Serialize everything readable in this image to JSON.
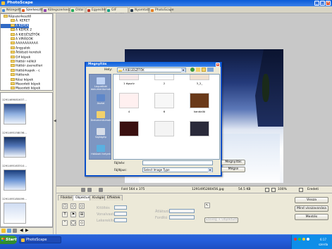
{
  "window": {
    "title": "PhotoScape",
    "min": "_",
    "max": "□",
    "close": "×"
  },
  "tabs": [
    {
      "label": "Nézegető",
      "color": "#4a8ad8"
    },
    {
      "label": "Szerkesztő",
      "color": "#e05a20"
    },
    {
      "label": "Kötegszerkesztő",
      "color": "#8e44ad"
    },
    {
      "label": "Oldal",
      "color": "#27ae60"
    },
    {
      "label": "Egyesítés",
      "color": "#c0392b"
    },
    {
      "label": "GIF animálás",
      "color": "#16a085"
    },
    {
      "label": "Nyomtatás",
      "color": "#2c3e50"
    },
    {
      "label": "PhotoScape",
      "color": "#e67e22"
    }
  ],
  "tree": [
    "Képszerkesztő",
    "Á. KERET",
    "A KÉPEK",
    "A KÉPEK 2",
    "A KIEGÉSZÍTŐK",
    "A VIRÁGOK",
    "AAAAAAAAAA",
    "Angyalok",
    "Átlátszó keretek",
    "Gif képek",
    "Háttér nélkül",
    "Háttér zseneilleri",
    "Háttérkapok - c",
    "Hátterek",
    "Kész képek",
    "Masodeti képek",
    "Masodeti képek"
  ],
  "thumbs": [
    {
      "caption": "1291469081637..."
    },
    {
      "caption": "1291495158036..."
    },
    {
      "caption": "1291495163310..."
    },
    {
      "caption": "1291495180499..."
    }
  ],
  "status": {
    "size": "Fold 564 x 375",
    "filename": "1291495280456.jpg",
    "filesize": "54.5 KB",
    "zoom": "100%",
    "fit": "Eredeti"
  },
  "edit_tabs": [
    "Főoldal",
    "Objektum",
    "Kivágás",
    "Effektek"
  ],
  "edit": {
    "label1": "Kitöltés",
    "label2": "Vonalvastagság",
    "label3": "Lekerekítés",
    "label4": "Átlátszó",
    "label5": "Fordító",
    "btn_text": "Szöveg + Objektum"
  },
  "right_buttons": {
    "undo": "Vissza",
    "undo_all": "Mind visszavonása",
    "save": "Mentés"
  },
  "taskbar": {
    "start": "Start",
    "app": "PhotoScape",
    "time": "6:17",
    "day": "szerda"
  },
  "dialog": {
    "title": "Megnyitás",
    "look_in_label": "Hely:",
    "folder": "A KIEGÉSZÍTŐK",
    "places": [
      "Legutóbbi dokumentumok",
      "Asztal",
      "Dokumentumok",
      "Sajátgép",
      "Hálózati helyek"
    ],
    "files": [
      {
        "label": "1 égszív"
      },
      {
        "label": "2"
      },
      {
        "label": "3_2_"
      },
      {
        "label": "4"
      },
      {
        "label": "6"
      },
      {
        "label": "kandalló"
      },
      {
        "label": ""
      },
      {
        "label": ""
      },
      {
        "label": ""
      }
    ],
    "filename_label": "Fájlnév:",
    "filetype_label": "Fájltípus:",
    "filename_value": "",
    "filetype_value": "Select Image Type",
    "open_button": "Megnyitás",
    "cancel_button": "Mégse"
  }
}
